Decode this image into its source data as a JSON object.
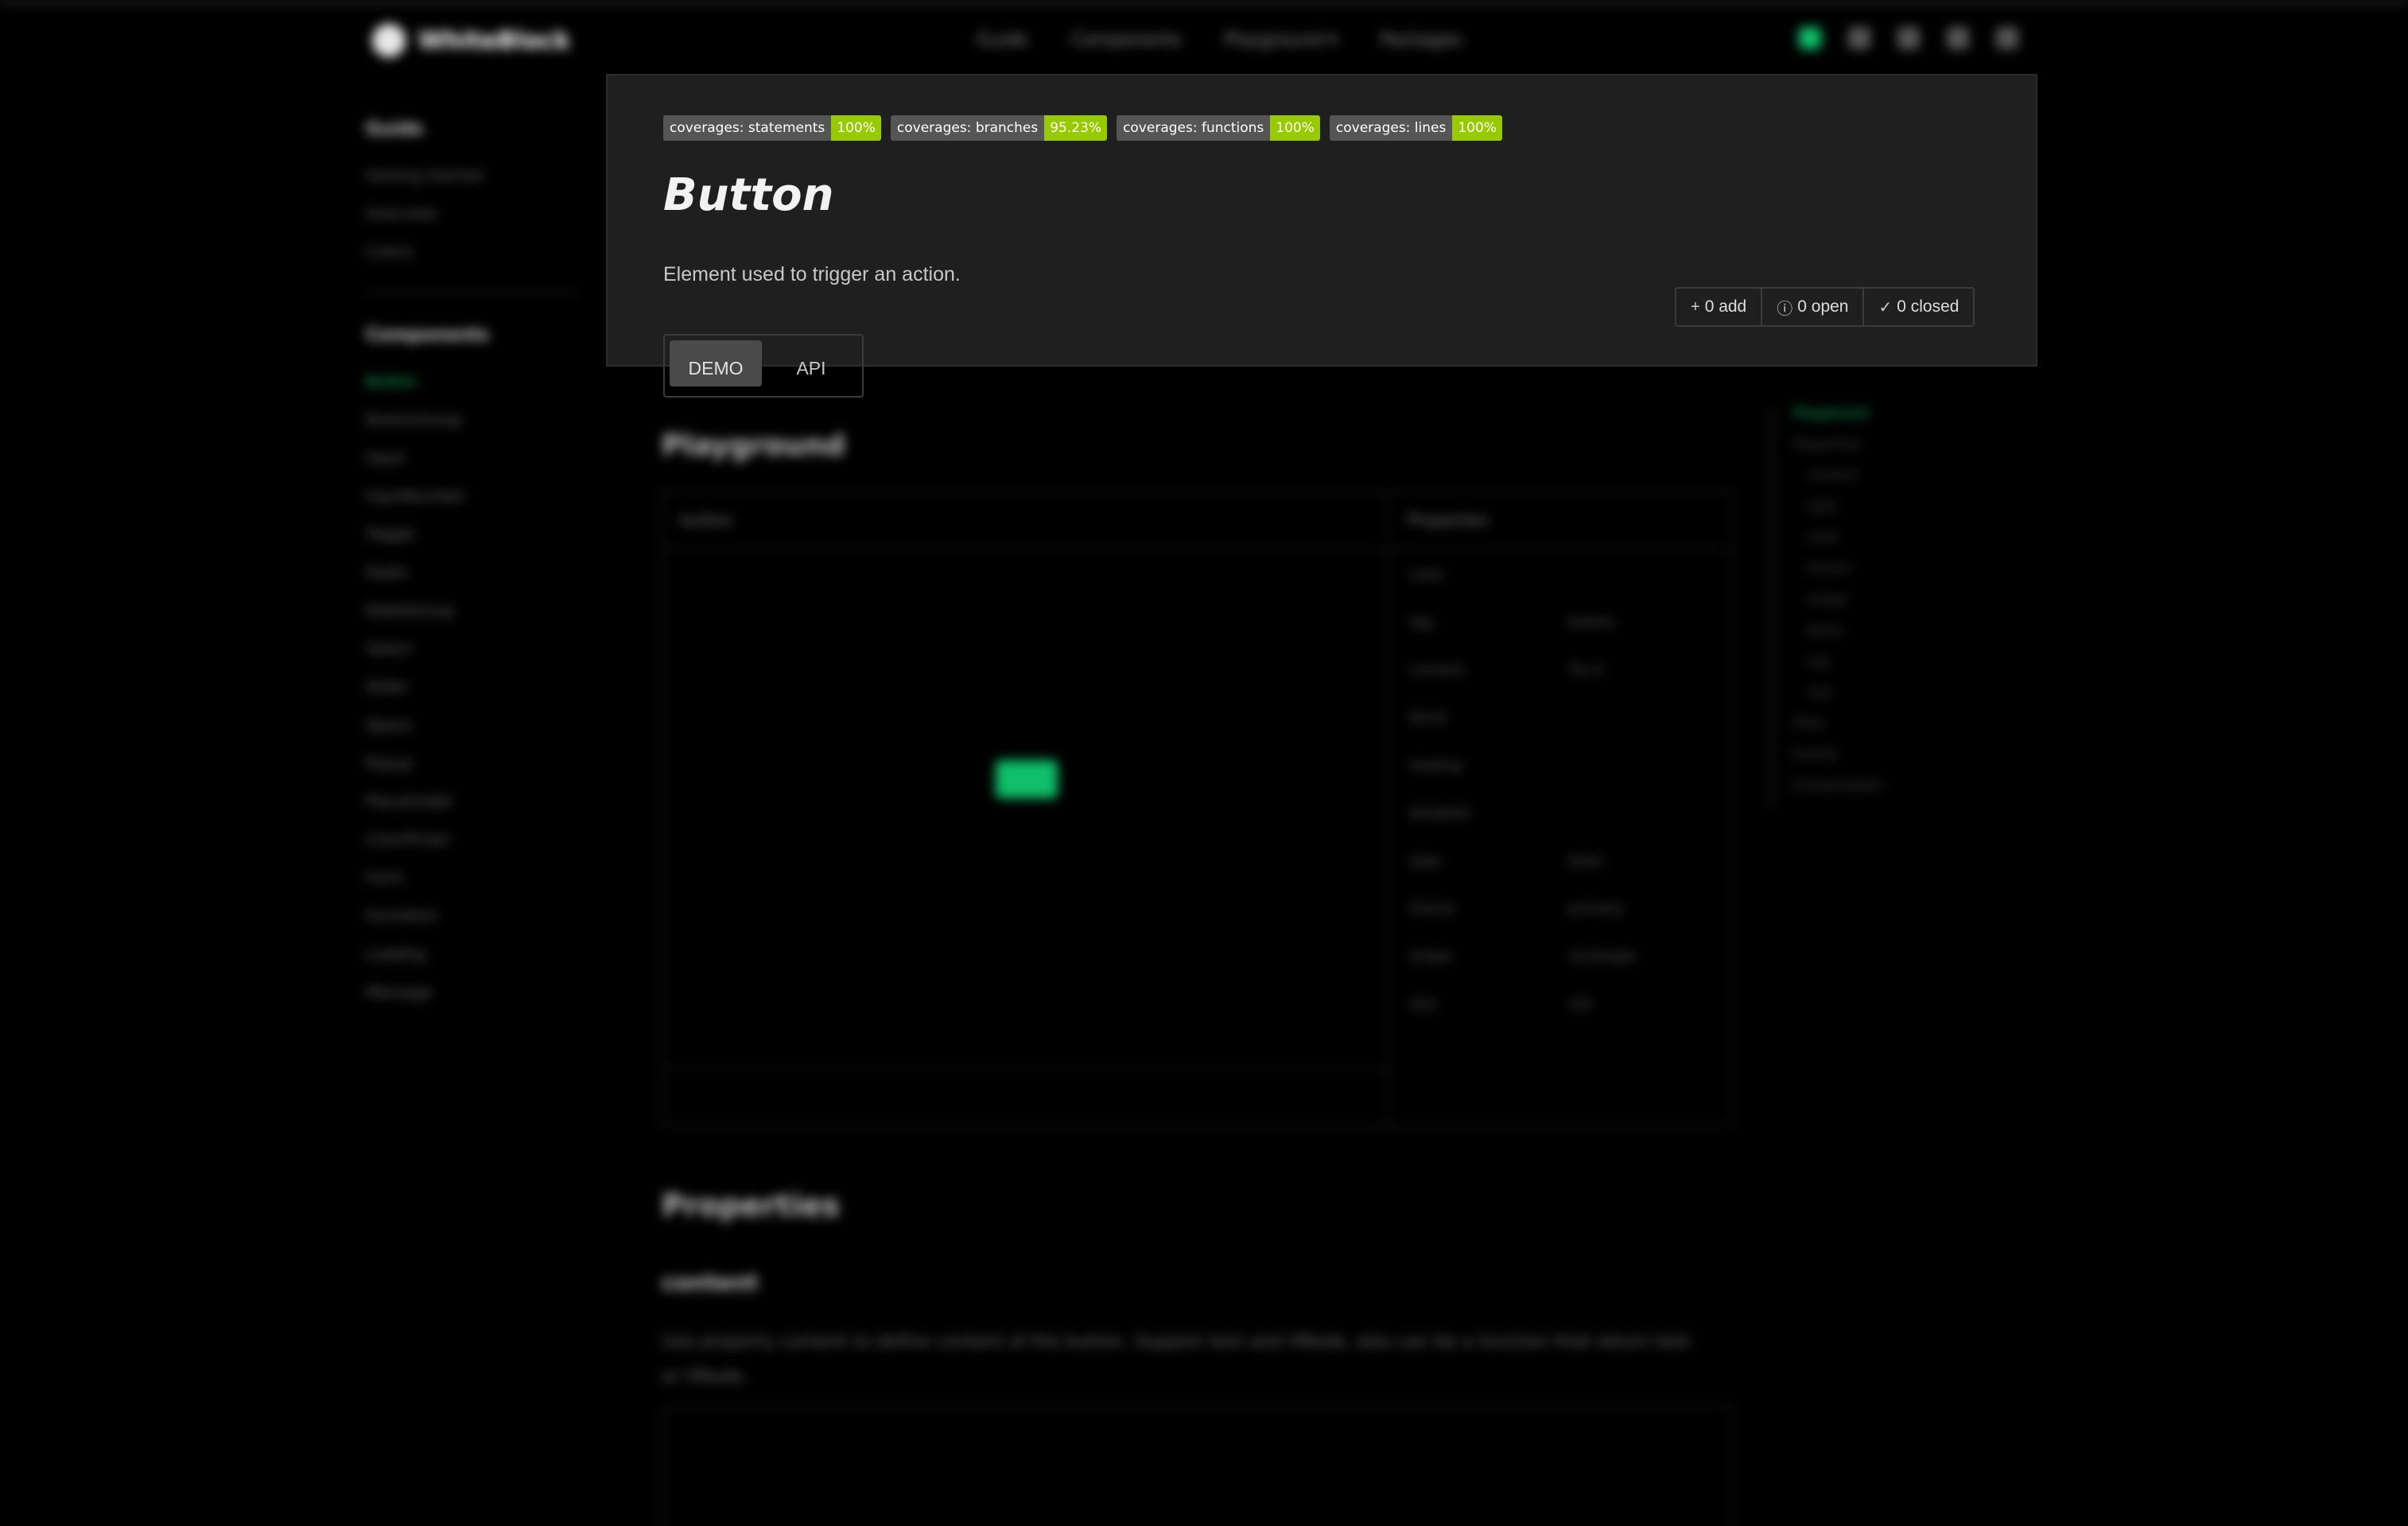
{
  "topbar": {
    "logo_text": "WhiteBlock",
    "nav": [
      "Guide",
      "Components",
      "Playground ▾",
      "Packages"
    ],
    "icons": [
      "flag-icon",
      "search-icon",
      "translate-icon",
      "moon-icon",
      "github-icon"
    ]
  },
  "sidebar": {
    "guide_title": "Guide",
    "guide_items": [
      "Getting Started",
      "Overview",
      "Colors"
    ],
    "components_title": "Components",
    "component_items": [
      "Button",
      "ButtonGroup",
      "Input",
      "InputNumber",
      "Toggle",
      "Radio",
      "RadioGroup",
      "Select",
      "Slider",
      "Space",
      "Popup",
      "Placeholder",
      "ColorPicker",
      "Form",
      "FormItem",
      "Loading",
      "Message"
    ],
    "active_item": "Button"
  },
  "header": {
    "badges": [
      {
        "label": "coverages: statements",
        "value": "100%"
      },
      {
        "label": "coverages: branches",
        "value": "95.23%"
      },
      {
        "label": "coverages: functions",
        "value": "100%"
      },
      {
        "label": "coverages: lines",
        "value": "100%"
      }
    ],
    "title": "Button",
    "description": "Element used to trigger an action.",
    "issues": {
      "add": "0 add",
      "open": "0 open",
      "closed": "0 closed"
    },
    "tabs": [
      "DEMO",
      "API"
    ],
    "active_tab": "DEMO"
  },
  "playground": {
    "title": "Playground",
    "preview_label": "button",
    "properties_label": "Properties",
    "demo_button": "Try it",
    "props": [
      {
        "name": "color",
        "value": ""
      },
      {
        "name": "tag",
        "value": "button"
      },
      {
        "name": "content",
        "value": "Try it"
      },
      {
        "name": "block",
        "value": ""
      },
      {
        "name": "loading",
        "value": ""
      },
      {
        "name": "disabled",
        "value": ""
      },
      {
        "name": "type",
        "value": "base"
      },
      {
        "name": "theme",
        "value": "primary"
      },
      {
        "name": "shape",
        "value": "rectangle"
      },
      {
        "name": "size",
        "value": "md"
      }
    ]
  },
  "toc": [
    "Playground",
    "Properties",
    "content",
    "type",
    "color",
    "theme",
    "shape",
    "block",
    "tag",
    "size",
    "Slots",
    "Events",
    "Composables"
  ],
  "properties_section": {
    "title": "Properties",
    "sub_title": "content",
    "text": "Use property content to define content of the button. Support text and VNode, also can be a function that return text or VNode."
  }
}
